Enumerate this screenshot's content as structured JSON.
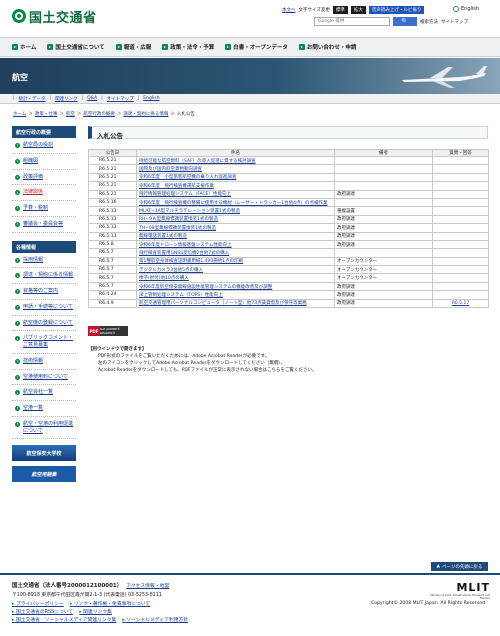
{
  "header": {
    "logo_text": "国土交通省",
    "text_links": [
      "本文へ",
      "文字サイズ変更"
    ],
    "size_buttons": [
      "標準",
      "拡大"
    ],
    "speech_button": "音声読み上げ・ルビ振り",
    "english": "English",
    "search_placeholder": "Google 提供",
    "search_button": "🔍",
    "search_help": "検索方法",
    "sitemap": "サイトマップ"
  },
  "global_nav": [
    "ホーム",
    "国土交通省について",
    "報道・広報",
    "政策・法令・予算",
    "白書・オープンデータ",
    "お問い合わせ・申請"
  ],
  "banner": {
    "title": "航空"
  },
  "sub_nav": [
    "統計・データ",
    "関連リンク",
    "Q&A",
    "サイトマップ",
    "English"
  ],
  "breadcrumb": [
    "ホーム",
    "政策・仕事",
    "航空",
    "航空行政の概要",
    "調達・契約に係る情報",
    "入札公告"
  ],
  "sidebar": {
    "section1_title": "航空行政の概要",
    "section1_items": [
      "航空局の役割",
      "組織図",
      "政策評価",
      "法律関係",
      "予算・税制",
      "審議会・委員会等"
    ],
    "section2_title": "各種情報",
    "section2_items": [
      "採用情報",
      "調達・契約に係る情報",
      "資格等のご案内",
      "申請・手続等について",
      "航空機の登録について",
      "パブリックコメント・ご意見募集",
      "技術情報",
      "空港使用料について",
      "航空会社一覧",
      "空港一覧",
      "航空・空港の利用促進について"
    ],
    "banner_school": "航空保安大学校",
    "banner_aviation": "航空用語集"
  },
  "main": {
    "title": "入札公告",
    "table": {
      "headers": [
        "公告日",
        "件名",
        "備考",
        "質問・回答"
      ],
      "rows": [
        {
          "date": "R6.5.21",
          "title": "持続可能な航空燃料（SAF）の導入促進に資する検討調査",
          "note": "",
          "qa": ""
        },
        {
          "date": "R6.5.21",
          "title": "国際及び国内航空貨物動向調査",
          "note": "",
          "qa": ""
        },
        {
          "date": "R6.5.21",
          "title": "令和6年度　小型旅客航空機の乗り入れ促進調査",
          "note": "",
          "qa": ""
        },
        {
          "date": "R6.5.21",
          "title": "令和6年度　飛行検査機運航支援作業",
          "note": "",
          "qa": ""
        },
        {
          "date": "R6.5.21",
          "title": "飛行情報管理処理システム（FACE）性能向上",
          "note": "政府調達",
          "qa": ""
        },
        {
          "date": "R6.5.16",
          "title": "令和6年度　飛行検査機の整備に使用する機材（レーザー・トラッカー1台他4点）の点検作業",
          "note": "",
          "qa": ""
        },
        {
          "date": "R6.5.13",
          "title": "MLAT−3A型マルチラテレーション装置1式の製造",
          "note": "重複設置",
          "qa": ""
        },
        {
          "date": "R6.5.13",
          "title": "RH−9Ａ型無線標識装置換装1式の製造",
          "note": "政府調達",
          "qa": ""
        },
        {
          "date": "R6.5.13",
          "title": "TH−08型無線標識装置換装1式の製造",
          "note": "政府調達",
          "qa": ""
        },
        {
          "date": "R6.5.13",
          "title": "無線電話装置1式の製造",
          "note": "政府調達",
          "qa": ""
        },
        {
          "date": "R6.5.8",
          "title": "令和6年度ドローン情報基盤システム性能向上",
          "note": "政府調達",
          "qa": ""
        },
        {
          "date": "R6.5.7",
          "title": "飛行検査装置用GNSS受信機2台他7式の購入",
          "note": "",
          "qa": ""
        },
        {
          "date": "R6.5.7",
          "title": "第1種航空身体検査証明書用紙1,400冊他1点の印刷",
          "note": "オープンカウンター",
          "qa": ""
        },
        {
          "date": "R6.5.7",
          "title": "デジタルカメラ3台他5点の購入",
          "note": "オープンカウンター",
          "qa": ""
        },
        {
          "date": "R6.5.7",
          "title": "椅子(肘付)他10点の購入",
          "note": "オープンカウンター",
          "qa": ""
        },
        {
          "date": "R6.5.7",
          "title": "令和6年度航空保安無線施設性能管理システムの機能改善及び調整",
          "note": "政府調達",
          "qa": ""
        },
        {
          "date": "R6.4.24",
          "title": "洋上管制処理システム（TOPS）性能向上",
          "note": "政府調達",
          "qa": ""
        },
        {
          "date": "R6.4.9",
          "title": "航空交通管理用パーソナルコンピュータ（ノート型）他73点賃貸借及び保守等業務",
          "note": "政府調達",
          "qa": "R6.5.17"
        }
      ]
    },
    "pdf_badge": [
      "PDF",
      "Get ADOBE® READER®"
    ],
    "help_title": "【別ウインドウで開きます】",
    "help_lines": [
      "PDF形式のファイルをご覧いただくためには、Adobe Acrobat Readerが必要です。",
      "左のアイコンをクリックしてAdobe Acrobat Readerをダウンロードしてください（無償）。",
      "Acrobat Readerをダウンロードしても、PDFファイルが正常に表示されない場合はこちらをご覧ください。"
    ]
  },
  "page_top": "ページの先頭に戻る",
  "footer": {
    "org": "国土交通省（法人番号2000012100001）",
    "access": "アクセス情報・地図",
    "address": "〒100-8918 東京都千代田区霞が関2-1-3 (代表電話) 03-5253-8111",
    "links_row1": [
      "プライバシーポリシー",
      "リンク・著作権・免責事項について"
    ],
    "links_row2": [
      "国土交通省のRSSについて",
      "関連リンク集"
    ],
    "links_row3": [
      "国土交通省　ソーシャルメディア関連リンク集",
      "ソーシャルメディア利用方針"
    ],
    "logo_text": "MLIT",
    "logo_sub": "Ministry of Land, Infrastructure, Transport and Tourism",
    "copyright": "Copyright© 2008 MLIT Japan. All Rights Reserved."
  },
  "colors": {
    "brand_green": "#0a8a4a",
    "navy": "#1c4a79",
    "link": "#1a3d8f"
  }
}
